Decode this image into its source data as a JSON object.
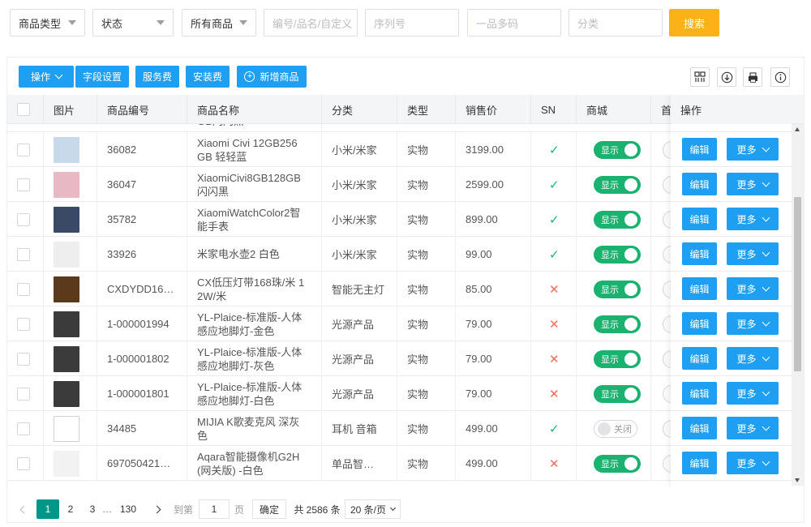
{
  "filters": {
    "product_type": "商品类型",
    "status": "状态",
    "all_goods": "所有商品",
    "code_placeholder": "编号/品名/自定义",
    "serial_placeholder": "序列号",
    "multi_code_placeholder": "一品多码",
    "category_placeholder": "分类",
    "search_label": "搜索"
  },
  "toolbar": {
    "operate_label": "操作",
    "field_settings_label": "字段设置",
    "service_fee_label": "服务费",
    "install_fee_label": "安装费",
    "add_goods_label": "新增商品",
    "icons": [
      "layout-grid-icon",
      "download-icon",
      "print-icon",
      "info-icon"
    ]
  },
  "table": {
    "columns": {
      "image": "图片",
      "code": "商品编号",
      "name": "商品名称",
      "category": "分类",
      "type": "类型",
      "price": "销售价",
      "sn": "SN",
      "mall": "商城",
      "partial": "首",
      "actions": "操作"
    },
    "partial_top_name": "GB闪闪黑",
    "rows": [
      {
        "code": "36082",
        "name1": "Xiaomi Civi 12GB256",
        "name2": "GB 轻轻蓝",
        "category": "小米/米家",
        "type": "实物",
        "price": "3199.00",
        "sn": "✓",
        "sn_ok": true,
        "mall": "显示",
        "mall_on": true,
        "thumb": "#c7d9ea"
      },
      {
        "code": "36047",
        "name1": "XiaomiCivi8GB128GB",
        "name2": "闪闪黑",
        "category": "小米/米家",
        "type": "实物",
        "price": "2599.00",
        "sn": "✓",
        "sn_ok": true,
        "mall": "显示",
        "mall_on": true,
        "thumb": "#e8b9c4"
      },
      {
        "code": "35782",
        "name1": "XiaomiWatchColor2智",
        "name2": "能手表",
        "category": "小米/米家",
        "type": "实物",
        "price": "899.00",
        "sn": "✓",
        "sn_ok": true,
        "mall": "显示",
        "mall_on": true,
        "thumb": "#3a4a66"
      },
      {
        "code": "33926",
        "name1": "米家电水壶2 白色",
        "name2": "",
        "category": "小米/米家",
        "type": "实物",
        "price": "99.00",
        "sn": "✓",
        "sn_ok": true,
        "mall": "显示",
        "mall_on": true,
        "thumb": "#eeeeee"
      },
      {
        "code": "CXDYDD16…",
        "name1": "CX低压灯带168珠/米 1",
        "name2": "2W/米",
        "category": "智能无主灯",
        "type": "实物",
        "price": "85.00",
        "sn": "✕",
        "sn_ok": false,
        "mall": "显示",
        "mall_on": true,
        "thumb": "#5a3a1a"
      },
      {
        "code": "1-000001994",
        "name1": "YL-Plaice-标准版-人体",
        "name2": "感应地脚灯-金色",
        "category": "光源产品",
        "type": "实物",
        "price": "79.00",
        "sn": "✕",
        "sn_ok": false,
        "mall": "显示",
        "mall_on": true,
        "thumb": "#3b3b3b"
      },
      {
        "code": "1-000001802",
        "name1": "YL-Plaice-标准版-人体",
        "name2": "感应地脚灯-灰色",
        "category": "光源产品",
        "type": "实物",
        "price": "79.00",
        "sn": "✕",
        "sn_ok": false,
        "mall": "显示",
        "mall_on": true,
        "thumb": "#3b3b3b"
      },
      {
        "code": "1-000001801",
        "name1": "YL-Plaice-标准版-人体",
        "name2": "感应地脚灯-白色",
        "category": "光源产品",
        "type": "实物",
        "price": "79.00",
        "sn": "✕",
        "sn_ok": false,
        "mall": "显示",
        "mall_on": true,
        "thumb": "#3b3b3b"
      },
      {
        "code": "34485",
        "name1": "MIJIA K歌麦克风 深灰",
        "name2": "色",
        "category": "耳机 音箱",
        "type": "实物",
        "price": "499.00",
        "sn": "✓",
        "sn_ok": true,
        "mall": "关闭",
        "mall_on": false,
        "thumb": "#ffffff"
      },
      {
        "code": "697050421…",
        "name1": "Aqara智能摄像机G2H",
        "name2": "(网关版) -白色",
        "category": "单品智…",
        "type": "实物",
        "price": "499.00",
        "sn": "✕",
        "sn_ok": false,
        "mall": "显示",
        "mall_on": true,
        "thumb": "#f2f2f2"
      }
    ],
    "edit_label": "编辑",
    "more_label": "更多"
  },
  "pager": {
    "pages": [
      "1",
      "2",
      "3",
      "…",
      "130"
    ],
    "goto_label": "到第",
    "goto_value": "1",
    "page_unit": "页",
    "confirm_label": "确定",
    "total_text": "共 2586 条",
    "page_size": "20 条/页"
  },
  "colors": {
    "primary": "#1e9ff2",
    "search": "#fbb216",
    "toggle_on": "#1bb16f",
    "page_active": "#009688",
    "check": "#19b07b",
    "cross": "#f36c57"
  }
}
